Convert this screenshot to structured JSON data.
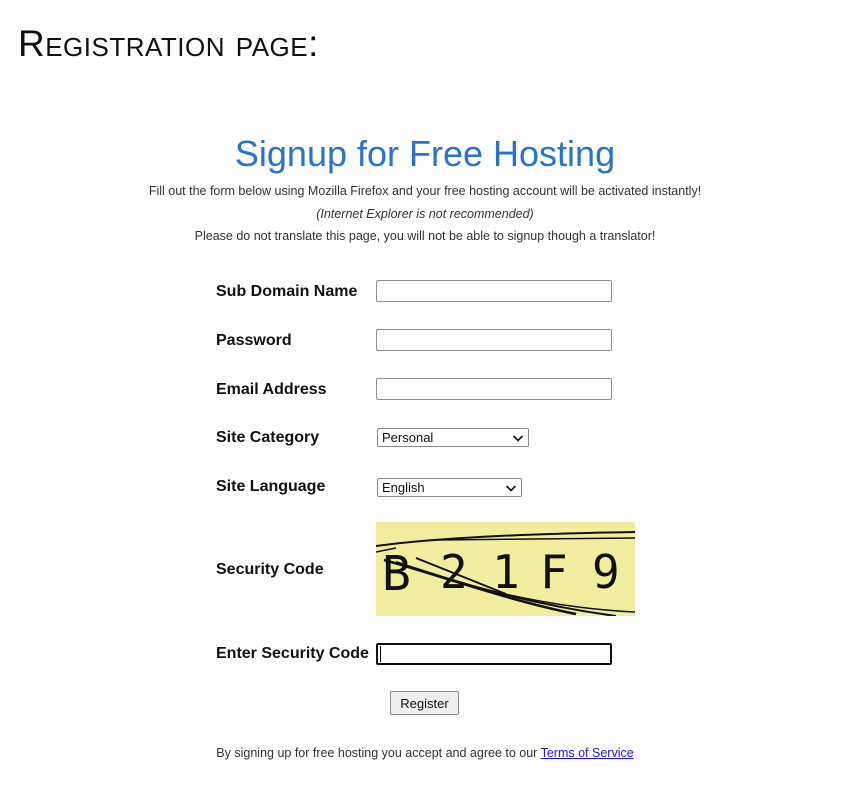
{
  "document": {
    "heading": "Registration page:"
  },
  "page": {
    "title": "Signup for Free Hosting",
    "notes": [
      "Fill out the form below using Mozilla Firefox and your free hosting account will be activated instantly!",
      "(Internet Explorer is not recommended)",
      "Please do not translate this page, you will not be able to signup though a translator!"
    ]
  },
  "form": {
    "subdomain": {
      "label": "Sub Domain Name",
      "value": ""
    },
    "password": {
      "label": "Password",
      "value": ""
    },
    "email": {
      "label": "Email Address",
      "value": ""
    },
    "site_category": {
      "label": "Site Category",
      "selected": "Personal"
    },
    "site_language": {
      "label": "Site Language",
      "selected": "English"
    },
    "security_code": {
      "label": "Security Code",
      "captcha_text": "B21F9"
    },
    "enter_security_code": {
      "label": "Enter Security Code",
      "value": ""
    },
    "register_label": "Register"
  },
  "footer": {
    "text": "By signing up for free hosting you accept and agree to our ",
    "link_label": "Terms of Service"
  },
  "colors": {
    "title": "#2a73c8",
    "captcha_bg": "#f0ee9e",
    "link": "#1a1aee"
  }
}
